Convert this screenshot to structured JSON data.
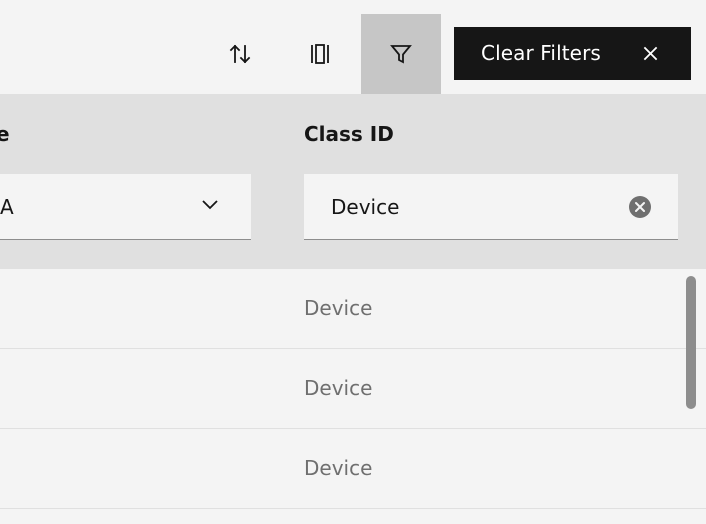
{
  "toolbar": {
    "sort_icon": "sort-arrows-icon",
    "columns_icon": "column-settings-icon",
    "filter_icon": "filter-funnel-icon",
    "clear_filters_label": "Clear Filters",
    "clear_filters_icon": "close-icon"
  },
  "filters": {
    "left_column_label": "e",
    "left_select_value": "A",
    "right_column_label": "Class ID",
    "right_input_value": "Device",
    "right_input_clear_icon": "clear-circle-icon"
  },
  "rows": [
    {
      "class_id": "Device"
    },
    {
      "class_id": "Device"
    },
    {
      "class_id": "Device"
    }
  ],
  "colors": {
    "background": "#f4f4f4",
    "panel": "#e0e0e0",
    "active_tool": "#c6c6c6",
    "primary_button": "#161616",
    "secondary_text": "#6f6f6f",
    "scrollbar": "#8d8d8d"
  }
}
